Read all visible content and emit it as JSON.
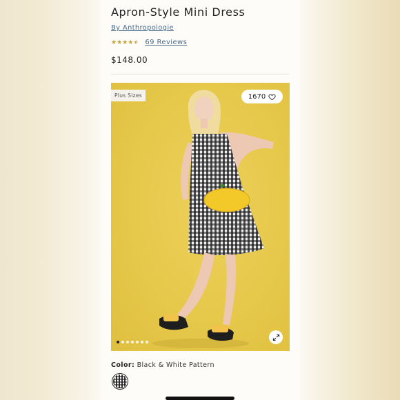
{
  "product": {
    "title": "Apron-Style Mini Dress",
    "brand": "By Anthropologie",
    "rating": 4.5,
    "reviews_label": "69 Reviews",
    "price": "$148.00"
  },
  "gallery": {
    "badge": "Plus Sizes",
    "favorite_count": "1670",
    "image_count": 7,
    "active_index": 0,
    "background_color": "#e6c84a"
  },
  "color": {
    "label": "Color:",
    "value": "Black & White Pattern"
  },
  "icons": {
    "favorite": "heart-icon",
    "expand": "expand-icon"
  },
  "colors": {
    "accent_star": "#c9a13b",
    "link": "#4a6a8a"
  }
}
